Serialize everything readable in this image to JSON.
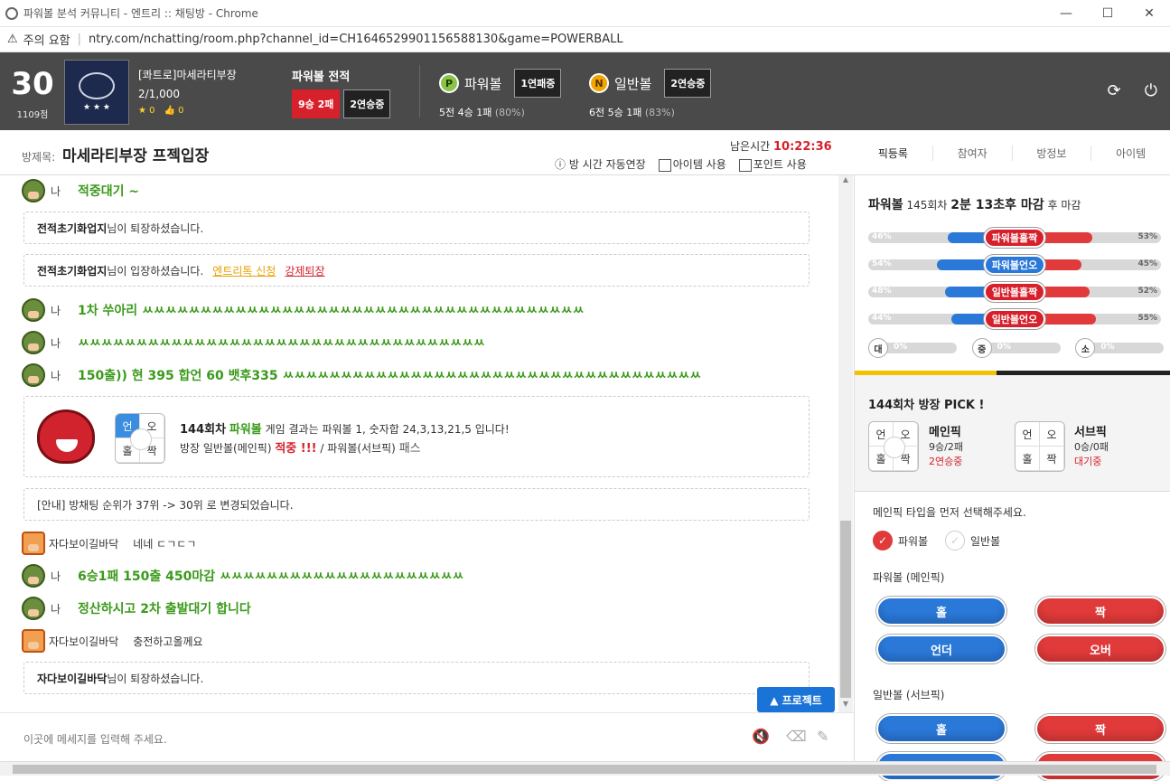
{
  "window": {
    "title": "파워볼 분석 커뮤니티 - 엔트리 :: 채팅방 - Chrome",
    "minimize": "—",
    "maximize": "☐",
    "close": "✕"
  },
  "url": {
    "warning": "주의 요함",
    "address": "ntry.com/nchatting/room.php?channel_id=CH1646529901156588130&game=POWERBALL"
  },
  "user": {
    "level": "30",
    "points": "1109점",
    "badge_text": "★ ★ ★",
    "name": "[콰트로]마세라티부장",
    "members": "2/1,000",
    "stars": "★ 0",
    "likes": "👍 0"
  },
  "record": {
    "title": "파워볼 전적",
    "winloss": "9승 2패",
    "streak": "2연승중"
  },
  "powerball": {
    "icon": "P",
    "label": "파워볼",
    "streak": "1연패중",
    "summary": "5전 4승 1패",
    "pct": "(80%)",
    "color": "#8bc34a"
  },
  "normalball": {
    "icon": "N",
    "label": "일반볼",
    "streak": "2연승중",
    "summary": "6전 5승 1패",
    "pct": "(83%)",
    "color": "#f0a500"
  },
  "top_icons": {
    "refresh": "⟳",
    "power": "⏻"
  },
  "room": {
    "label": "방제목:",
    "title": "마세라티부장 프젝입장",
    "time_label": "남은시간",
    "time": "10:22:36",
    "auto_extend": "ⓘ 방 시간 자동연장",
    "item_use": "아이템 사용",
    "point_use": "포인트 사용"
  },
  "tabs": [
    "픽등록",
    "참여자",
    "방정보",
    "아이템"
  ],
  "chat": {
    "me": "나",
    "m1": "적중대기 ~",
    "n1_nick": "전적초기화업지",
    "n1_text": "님이 퇴장하셨습니다.",
    "n2_nick": "전적초기화업지",
    "n2_text": "님이 입장하셨습니다.",
    "n2_link1": "엔트리톡 신청",
    "n2_link2": "강제퇴장",
    "m2": "1차 쑤아리 ㅆㅆㅆㅆㅆㅆㅆㅆㅆㅆㅆㅆㅆㅆㅆㅆㅆㅆㅆㅆㅆㅆㅆㅆㅆㅆㅆㅆㅆㅆㅆㅆㅆㅆㅆㅆㅆㅆ",
    "m3": "ㅆㅆㅆㅆㅆㅆㅆㅆㅆㅆㅆㅆㅆㅆㅆㅆㅆㅆㅆㅆㅆㅆㅆㅆㅆㅆㅆㅆㅆㅆㅆㅆㅆㅆㅆ",
    "m4": "150출)) 현 395 합언 60 뱃후335 ㅆㅆㅆㅆㅆㅆㅆㅆㅆㅆㅆㅆㅆㅆㅆㅆㅆㅆㅆㅆㅆㅆㅆㅆㅆㅆㅆㅆㅆㅆㅆㅆㅆㅆㅆㅆ",
    "result_grid": [
      "언",
      "오",
      "홀",
      "짝"
    ],
    "result_round": "144회차",
    "result_game": "파워볼",
    "result_text": "게임 결과는 파워볼 1, 숫자합 24,3,13,21,5 입니다!",
    "result_line2a": "방장 일반볼(메인픽)",
    "result_hit": "적중 !!!",
    "result_line2b": "/ 파워볼(서브픽)",
    "result_pass": "패스",
    "n3": "[안내] 방채팅 순위가 37위 -> 30위 로 변경되었습니다.",
    "u1_nick": "자다보이길바닥",
    "u1_text": "네네 ㄷㄱㄷㄱ",
    "m5": "6승1패 150출 450마감 ㅆㅆㅆㅆㅆㅆㅆㅆㅆㅆㅆㅆㅆㅆㅆㅆㅆㅆㅆㅆㅆ",
    "m6": "정산하시고 2차 출발대기 합니다",
    "u2_nick": "자다보이길바닥",
    "u2_text": "충전하고올께요",
    "n4_nick": "자다보이길바닥",
    "n4_text": "님이 퇴장하셨습니다.",
    "project_button": "▲ 프로젝트",
    "input_placeholder": "이곳에 메세지를 입력해 주세요.",
    "icon_mute": "🔇",
    "icon_erase": "⌫",
    "icon_magic": "✎"
  },
  "panel": {
    "title": "파워볼",
    "round": "145회차",
    "remain": "2분 13초후 마감",
    "remain_suffix": "후 마감",
    "bars": [
      {
        "left": "46%",
        "right": "53%",
        "label": "파워볼홀짝",
        "blue": 46,
        "pill": "#d6202b"
      },
      {
        "left": "54%",
        "right": "45%",
        "label": "파워볼언오",
        "blue": 54,
        "pill": "#2a78d8"
      },
      {
        "left": "48%",
        "right": "52%",
        "label": "일반볼홀짝",
        "blue": 48,
        "pill": "#d6202b"
      },
      {
        "left": "44%",
        "right": "55%",
        "label": "일반볼언오",
        "blue": 44,
        "pill": "#d6202b"
      }
    ],
    "mini": [
      {
        "icon": "대",
        "value": "0%"
      },
      {
        "icon": "중",
        "value": "0%"
      },
      {
        "icon": "소",
        "value": "0%"
      }
    ],
    "pick_title": "144회차 방장 PICK !",
    "main_grid": [
      "언",
      "오",
      "홀",
      "짝"
    ],
    "main_name": "메인픽",
    "main_record": "9승/2패",
    "main_streak": "2연승중",
    "sub_grid": [
      "언",
      "오",
      "홀",
      "짝"
    ],
    "sub_name": "서브픽",
    "sub_record": "0승/0패",
    "sub_streak": "대기중",
    "instruction": "메인픽 타입을 먼저 선택해주세요.",
    "opt_power": "파워볼",
    "opt_normal": "일반볼",
    "check": "✓",
    "power_main_label": "파워볼 (메인픽)",
    "btn_odd": "홀",
    "btn_even": "짝",
    "btn_under": "언더",
    "btn_over": "오버",
    "normal_sub_label": "일반볼 (서브픽)"
  }
}
